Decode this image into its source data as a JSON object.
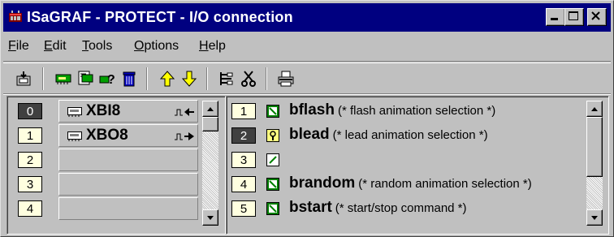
{
  "window": {
    "title": "ISaGRAF - PROTECT - I/O connection",
    "app_icon": "isagraf-app-icon",
    "controls": [
      "minimize-icon",
      "maximize-icon",
      "close-icon"
    ]
  },
  "menubar": {
    "items": [
      {
        "label": "File",
        "mnemonic": "F",
        "rest": "ile"
      },
      {
        "label": "Edit",
        "mnemonic": "E",
        "rest": "dit"
      },
      {
        "label": "Tools",
        "mnemonic": "T",
        "rest": "ools"
      },
      {
        "label": "Options",
        "mnemonic": "O",
        "rest": "ptions"
      },
      {
        "label": "Help",
        "mnemonic": "H",
        "rest": "elp"
      }
    ]
  },
  "toolbar": {
    "groups": [
      [
        "open-board-icon"
      ],
      [
        "set-board-icon",
        "set-equipment-icon",
        "help-board-icon",
        "delete-icon"
      ],
      [
        "move-up-icon",
        "move-down-icon"
      ],
      [
        "connect-icon",
        "disconnect-icon"
      ],
      [
        "print-icon"
      ]
    ]
  },
  "boards": {
    "selected_index": 0,
    "slots": [
      {
        "number": "0",
        "name": "XBI8",
        "direction": "input"
      },
      {
        "number": "1",
        "name": "XBO8",
        "direction": "output"
      },
      {
        "number": "2",
        "name": ""
      },
      {
        "number": "3",
        "name": ""
      },
      {
        "number": "4",
        "name": ""
      }
    ]
  },
  "channels": {
    "selected_index": 1,
    "rows": [
      {
        "number": "1",
        "icon": "connected-variable-icon",
        "name": "bflash",
        "comment": "(* flash animation selection *)"
      },
      {
        "number": "2",
        "icon": "locked-variable-icon",
        "name": "blead",
        "comment": "(* lead animation selection *)"
      },
      {
        "number": "3",
        "icon": "free-channel-icon",
        "name": "",
        "comment": ""
      },
      {
        "number": "4",
        "icon": "connected-variable-icon",
        "name": "brandom",
        "comment": "(* random animation selection *)"
      },
      {
        "number": "5",
        "icon": "connected-variable-icon",
        "name": "bstart",
        "comment": "(* start/stop command *)"
      }
    ]
  },
  "colors": {
    "titlebar": "#000080",
    "number_box": "#ffffe0",
    "selected_number_box": "#404040",
    "variable_icon_green": "#008000"
  }
}
